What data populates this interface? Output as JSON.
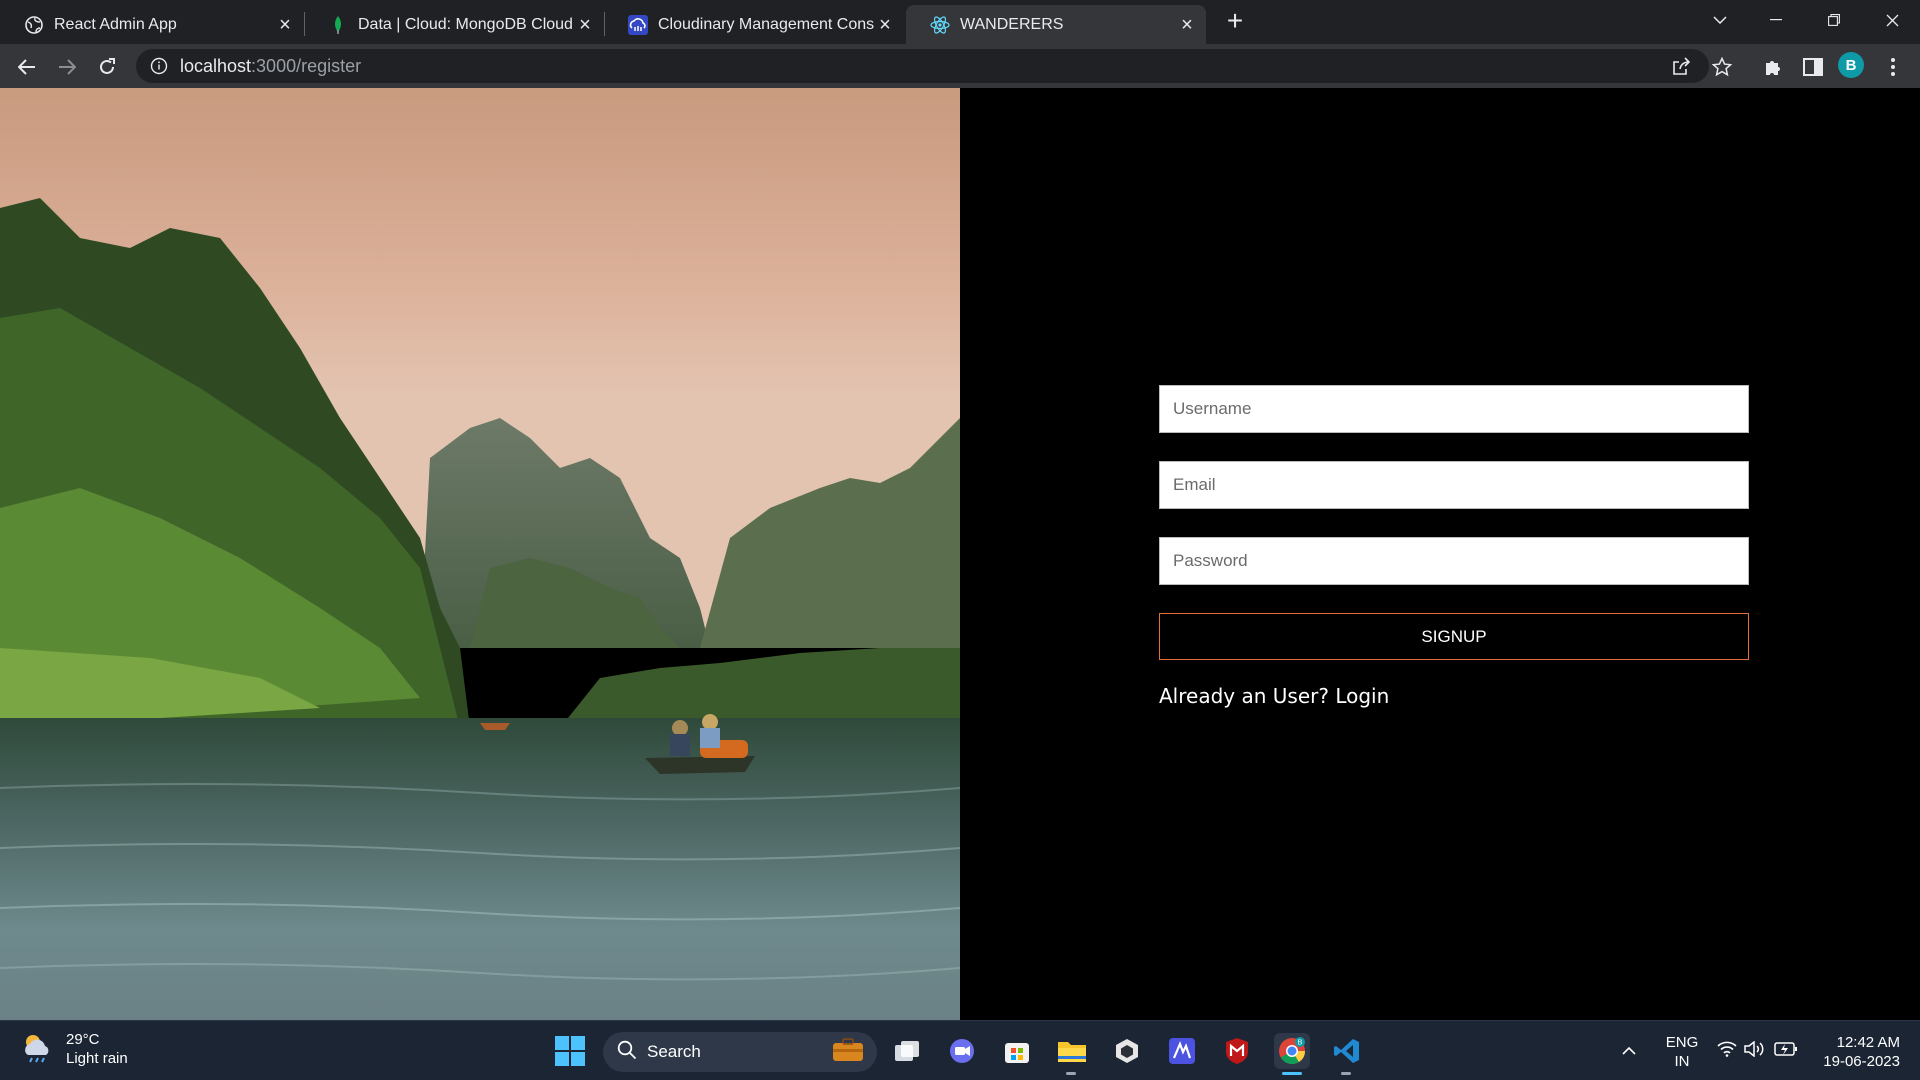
{
  "browser": {
    "tabs": [
      {
        "title": "React Admin App",
        "icon": "globe-icon"
      },
      {
        "title": "Data | Cloud: MongoDB Cloud",
        "icon": "mongodb-leaf-icon"
      },
      {
        "title": "Cloudinary Management Console",
        "icon": "cloudinary-icon"
      },
      {
        "title": "WANDERERS",
        "icon": "react-icon",
        "active": true
      }
    ],
    "url_host": "localhost",
    "url_path": ":3000/register",
    "profile_initial": "B"
  },
  "register": {
    "username_placeholder": "Username",
    "email_placeholder": "Email",
    "password_placeholder": "Password",
    "signup_label": "SIGNUP",
    "login_prompt": "Already an User?",
    "login_link": "Login",
    "accent": "#e0703a"
  },
  "taskbar": {
    "weather_temp": "29°C",
    "weather_desc": "Light rain",
    "search_label": "Search",
    "lang_top": "ENG",
    "lang_bottom": "IN",
    "time": "12:42 AM",
    "date": "19-06-2023"
  }
}
